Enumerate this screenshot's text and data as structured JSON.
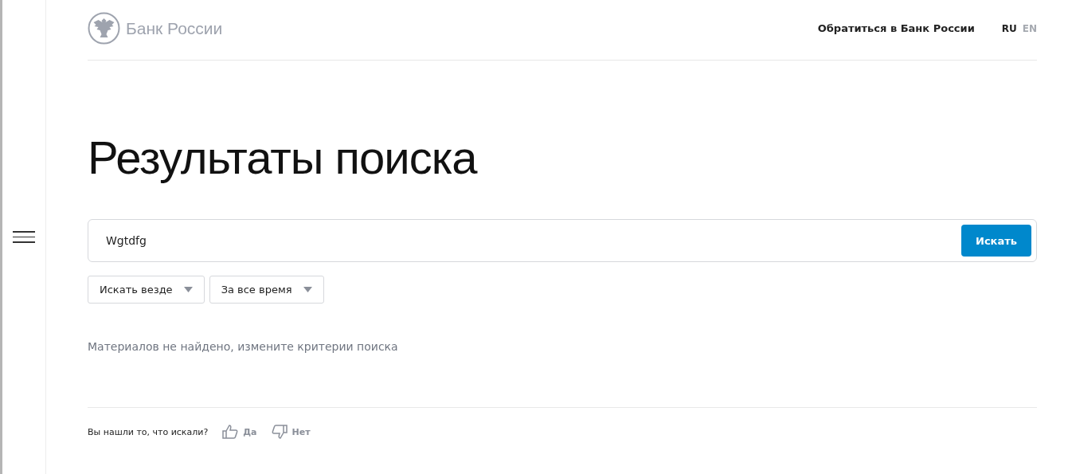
{
  "header": {
    "logo_text": "Банк России",
    "contact_link": "Обратиться в Банк России",
    "languages": [
      {
        "label": "RU",
        "selected": true
      },
      {
        "label": "EN",
        "selected": false
      }
    ]
  },
  "title": "Результаты поиска",
  "search": {
    "value": "Wgtdfg",
    "button": "Искать"
  },
  "filters": [
    {
      "label": "Искать везде"
    },
    {
      "label": "За все время"
    }
  ],
  "message": "Материалов не найдено, измените критерии поиска",
  "feedback": {
    "question": "Вы нашли то, что искали?",
    "yes": "Да",
    "no": "Нет"
  }
}
